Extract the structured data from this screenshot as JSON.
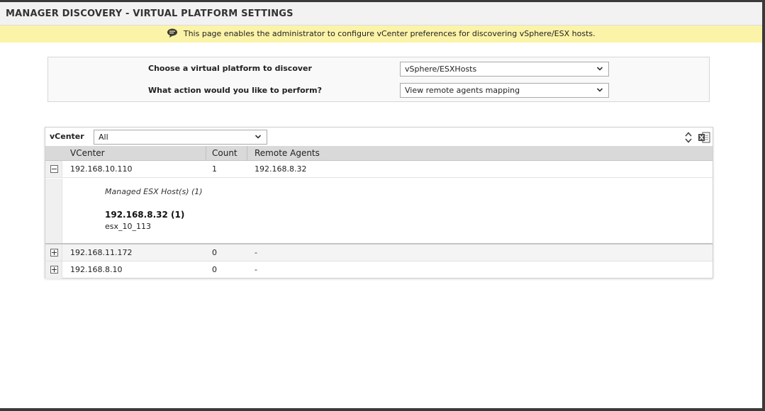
{
  "page": {
    "title": "MANAGER DISCOVERY - VIRTUAL PLATFORM SETTINGS",
    "info": "This page enables the administrator to configure vCenter preferences for discovering vSphere/ESX hosts."
  },
  "settings": {
    "platform_label": "Choose a virtual platform to discover",
    "platform_value": "vSphere/ESXHosts",
    "action_label": "What action would you like to perform?",
    "action_value": "View remote agents mapping"
  },
  "filter": {
    "label": "vCenter",
    "value": "All"
  },
  "grid": {
    "columns": [
      "VCenter",
      "Count",
      "Remote Agents"
    ],
    "rows": [
      {
        "vcenter": "192.168.10.110",
        "count": "1",
        "agents": "192.168.8.32",
        "expanded": true
      },
      {
        "vcenter": "192.168.11.172",
        "count": "0",
        "agents": "-",
        "expanded": false
      },
      {
        "vcenter": "192.168.8.10",
        "count": "0",
        "agents": "-",
        "expanded": false
      }
    ],
    "detail": {
      "heading": "Managed ESX Host(s) (1)",
      "agent": "192.168.8.32 (1)",
      "host": "esx_10_113"
    }
  },
  "icons": {
    "info": "speech-bubble-icon",
    "sort": "sort-updown-icon",
    "export": "excel-export-icon"
  },
  "colors": {
    "info_bar": "#fbf3a8",
    "grid_header": "#d9d9d9"
  }
}
